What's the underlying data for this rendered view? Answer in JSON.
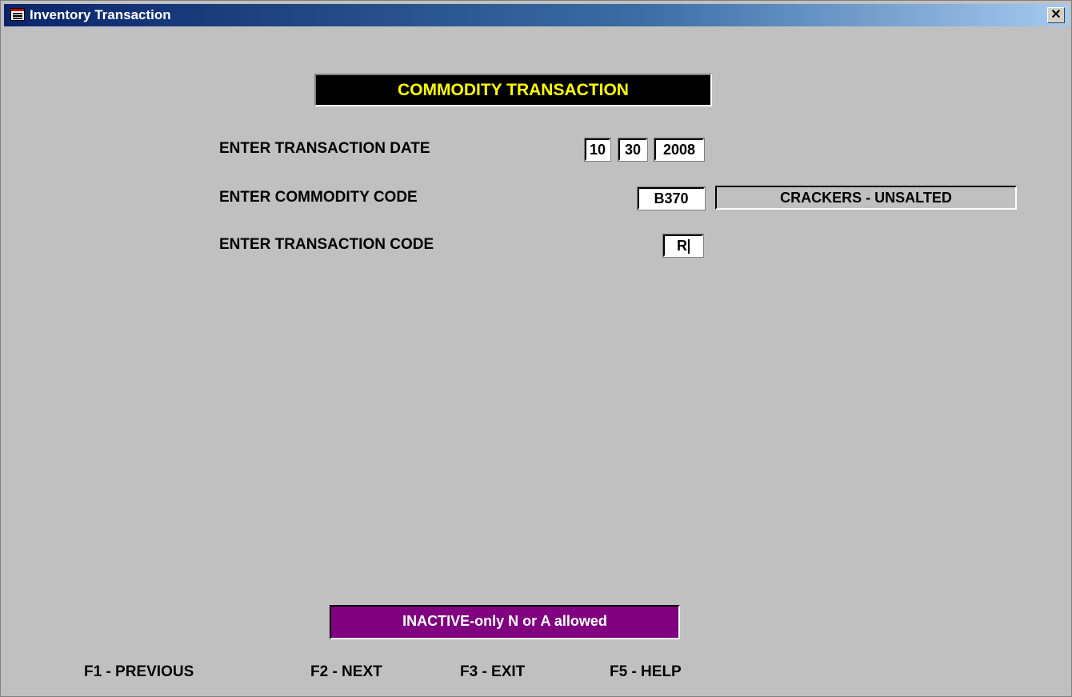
{
  "window": {
    "title": "Inventory Transaction",
    "close_label": "✕"
  },
  "banner": {
    "text": "COMMODITY TRANSACTION"
  },
  "form": {
    "date_label": "ENTER TRANSACTION DATE",
    "date_month": "10",
    "date_day": "30",
    "date_year": "2008",
    "commodity_label": "ENTER COMMODITY CODE",
    "commodity_code": "B370",
    "commodity_desc": "CRACKERS - UNSALTED",
    "transaction_label": "ENTER TRANSACTION CODE",
    "transaction_code": "R"
  },
  "status": {
    "message": "INACTIVE-only N or A allowed",
    "color": "#800080"
  },
  "function_keys": [
    {
      "label": "F1 - PREVIOUS"
    },
    {
      "label": "F2 - NEXT"
    },
    {
      "label": "F3 - EXIT"
    },
    {
      "label": "F5 - HELP"
    }
  ]
}
